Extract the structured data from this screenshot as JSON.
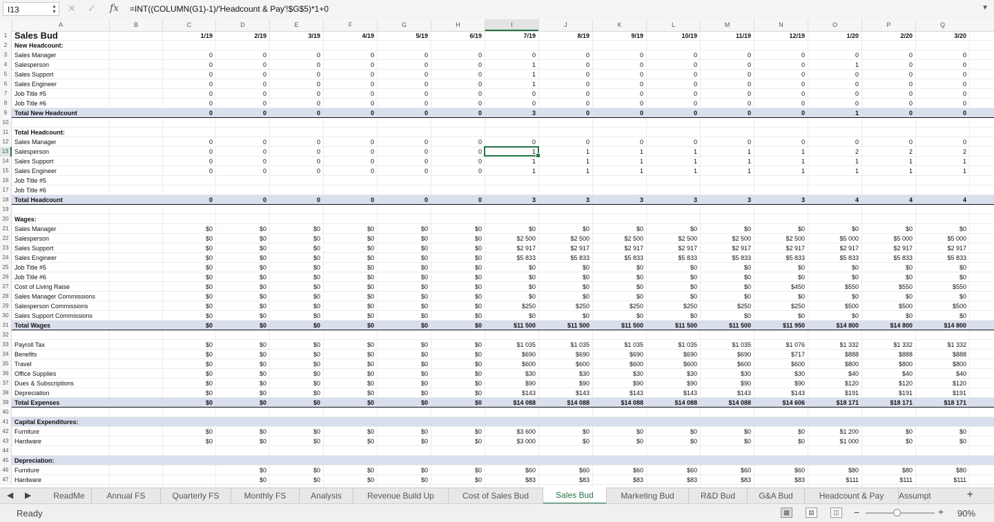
{
  "name_box": "I13",
  "formula": "=INT((COLUMN(G1)-1)/'Headcount & Pay'!$G$5)*1+0",
  "icons": {
    "cancel": "close-icon",
    "enter": "check-icon",
    "fx": "fx-icon"
  },
  "columns": [
    "A",
    "B",
    "C",
    "D",
    "E",
    "F",
    "G",
    "H",
    "I",
    "J",
    "K",
    "L",
    "M",
    "N",
    "O",
    "P",
    "Q"
  ],
  "selected_column": "I",
  "selected_row": 13,
  "selected_value": "1",
  "sheet_title": "Sales Bud",
  "rows": [
    {
      "n": 1,
      "label": "Sales Bud",
      "style": "title",
      "values": [
        "1/19",
        "2/19",
        "3/19",
        "4/19",
        "5/19",
        "6/19",
        "7/19",
        "8/19",
        "9/19",
        "10/19",
        "11/19",
        "12/19",
        "1/20",
        "2/20",
        "3/20"
      ],
      "bold": true
    },
    {
      "n": 2,
      "label": "New Headcount:",
      "style": "b",
      "values": []
    },
    {
      "n": 3,
      "label": "Sales Manager",
      "values": [
        "0",
        "0",
        "0",
        "0",
        "0",
        "0",
        "0",
        "0",
        "0",
        "0",
        "0",
        "0",
        "0",
        "0",
        "0"
      ]
    },
    {
      "n": 4,
      "label": "Salesperson",
      "values": [
        "0",
        "0",
        "0",
        "0",
        "0",
        "0",
        "1",
        "0",
        "0",
        "0",
        "0",
        "0",
        "1",
        "0",
        "0"
      ]
    },
    {
      "n": 5,
      "label": "Sales Support",
      "values": [
        "0",
        "0",
        "0",
        "0",
        "0",
        "0",
        "1",
        "0",
        "0",
        "0",
        "0",
        "0",
        "0",
        "0",
        "0"
      ]
    },
    {
      "n": 6,
      "label": "Sales Engineer",
      "values": [
        "0",
        "0",
        "0",
        "0",
        "0",
        "0",
        "1",
        "0",
        "0",
        "0",
        "0",
        "0",
        "0",
        "0",
        "0"
      ]
    },
    {
      "n": 7,
      "label": "Job Title #5",
      "values": [
        "0",
        "0",
        "0",
        "0",
        "0",
        "0",
        "0",
        "0",
        "0",
        "0",
        "0",
        "0",
        "0",
        "0",
        "0"
      ]
    },
    {
      "n": 8,
      "label": "Job Title #6",
      "values": [
        "0",
        "0",
        "0",
        "0",
        "0",
        "0",
        "0",
        "0",
        "0",
        "0",
        "0",
        "0",
        "0",
        "0",
        "0"
      ]
    },
    {
      "n": 9,
      "label": "Total New Headcount",
      "style": "b",
      "band": true,
      "total": true,
      "bold": true,
      "values": [
        "0",
        "0",
        "0",
        "0",
        "0",
        "0",
        "3",
        "0",
        "0",
        "0",
        "0",
        "0",
        "1",
        "0",
        "0"
      ]
    },
    {
      "n": 10,
      "label": "",
      "values": []
    },
    {
      "n": 11,
      "label": "Total Headcount:",
      "style": "b",
      "values": []
    },
    {
      "n": 12,
      "label": "Sales Manager",
      "values": [
        "0",
        "0",
        "0",
        "0",
        "0",
        "0",
        "0",
        "0",
        "0",
        "0",
        "0",
        "0",
        "0",
        "0",
        "0"
      ]
    },
    {
      "n": 13,
      "label": "Salesperson",
      "values": [
        "0",
        "0",
        "0",
        "0",
        "0",
        "0",
        "1",
        "1",
        "1",
        "1",
        "1",
        "1",
        "2",
        "2",
        "2"
      ]
    },
    {
      "n": 14,
      "label": "Sales Support",
      "values": [
        "0",
        "0",
        "0",
        "0",
        "0",
        "0",
        "1",
        "1",
        "1",
        "1",
        "1",
        "1",
        "1",
        "1",
        "1"
      ]
    },
    {
      "n": 15,
      "label": "Sales Engineer",
      "values": [
        "0",
        "0",
        "0",
        "0",
        "0",
        "0",
        "1",
        "1",
        "1",
        "1",
        "1",
        "1",
        "1",
        "1",
        "1"
      ]
    },
    {
      "n": 16,
      "label": "Job Title #5",
      "values": []
    },
    {
      "n": 17,
      "label": "Job Title #6",
      "values": []
    },
    {
      "n": 18,
      "label": "Total Headcount",
      "style": "b",
      "band": true,
      "total": true,
      "bold": true,
      "values": [
        "0",
        "0",
        "0",
        "0",
        "0",
        "0",
        "3",
        "3",
        "3",
        "3",
        "3",
        "3",
        "4",
        "4",
        "4"
      ]
    },
    {
      "n": 19,
      "label": "",
      "values": []
    },
    {
      "n": 20,
      "label": "Wages:",
      "style": "b",
      "values": []
    },
    {
      "n": 21,
      "label": "Sales Manager",
      "values": [
        "$0",
        "$0",
        "$0",
        "$0",
        "$0",
        "$0",
        "$0",
        "$0",
        "$0",
        "$0",
        "$0",
        "$0",
        "$0",
        "$0",
        "$0"
      ]
    },
    {
      "n": 22,
      "label": "Salesperson",
      "values": [
        "$0",
        "$0",
        "$0",
        "$0",
        "$0",
        "$0",
        "$2 500",
        "$2 500",
        "$2 500",
        "$2 500",
        "$2 500",
        "$2 500",
        "$5 000",
        "$5 000",
        "$5 000"
      ]
    },
    {
      "n": 23,
      "label": "Sales Support",
      "values": [
        "$0",
        "$0",
        "$0",
        "$0",
        "$0",
        "$0",
        "$2 917",
        "$2 917",
        "$2 917",
        "$2 917",
        "$2 917",
        "$2 917",
        "$2 917",
        "$2 917",
        "$2 917"
      ]
    },
    {
      "n": 24,
      "label": "Sales Engineer",
      "values": [
        "$0",
        "$0",
        "$0",
        "$0",
        "$0",
        "$0",
        "$5 833",
        "$5 833",
        "$5 833",
        "$5 833",
        "$5 833",
        "$5 833",
        "$5 833",
        "$5 833",
        "$5 833"
      ]
    },
    {
      "n": 25,
      "label": "Job Title #5",
      "values": [
        "$0",
        "$0",
        "$0",
        "$0",
        "$0",
        "$0",
        "$0",
        "$0",
        "$0",
        "$0",
        "$0",
        "$0",
        "$0",
        "$0",
        "$0"
      ]
    },
    {
      "n": 26,
      "label": "Job Title #6",
      "values": [
        "$0",
        "$0",
        "$0",
        "$0",
        "$0",
        "$0",
        "$0",
        "$0",
        "$0",
        "$0",
        "$0",
        "$0",
        "$0",
        "$0",
        "$0"
      ]
    },
    {
      "n": 27,
      "label": "Cost of Living Raise",
      "values": [
        "$0",
        "$0",
        "$0",
        "$0",
        "$0",
        "$0",
        "$0",
        "$0",
        "$0",
        "$0",
        "$0",
        "$450",
        "$550",
        "$550",
        "$550"
      ]
    },
    {
      "n": 28,
      "label": "Sales Manager Commissions",
      "values": [
        "$0",
        "$0",
        "$0",
        "$0",
        "$0",
        "$0",
        "$0",
        "$0",
        "$0",
        "$0",
        "$0",
        "$0",
        "$0",
        "$0",
        "$0"
      ]
    },
    {
      "n": 29,
      "label": "Salesperson Commissions",
      "values": [
        "$0",
        "$0",
        "$0",
        "$0",
        "$0",
        "$0",
        "$250",
        "$250",
        "$250",
        "$250",
        "$250",
        "$250",
        "$500",
        "$500",
        "$500"
      ]
    },
    {
      "n": 30,
      "label": "Sales Support Commissions",
      "values": [
        "$0",
        "$0",
        "$0",
        "$0",
        "$0",
        "$0",
        "$0",
        "$0",
        "$0",
        "$0",
        "$0",
        "$0",
        "$0",
        "$0",
        "$0"
      ]
    },
    {
      "n": 31,
      "label": "Total Wages",
      "style": "b",
      "band": true,
      "total": true,
      "bold": true,
      "values": [
        "$0",
        "$0",
        "$0",
        "$0",
        "$0",
        "$0",
        "$11 500",
        "$11 500",
        "$11 500",
        "$11 500",
        "$11 500",
        "$11 950",
        "$14 800",
        "$14 800",
        "$14 800"
      ]
    },
    {
      "n": 32,
      "label": "",
      "values": []
    },
    {
      "n": 33,
      "label": "Payroll Tax",
      "values": [
        "$0",
        "$0",
        "$0",
        "$0",
        "$0",
        "$0",
        "$1 035",
        "$1 035",
        "$1 035",
        "$1 035",
        "$1 035",
        "$1 076",
        "$1 332",
        "$1 332",
        "$1 332"
      ]
    },
    {
      "n": 34,
      "label": "Benefits",
      "values": [
        "$0",
        "$0",
        "$0",
        "$0",
        "$0",
        "$0",
        "$690",
        "$690",
        "$690",
        "$690",
        "$690",
        "$717",
        "$888",
        "$888",
        "$888"
      ]
    },
    {
      "n": 35,
      "label": "Travel",
      "values": [
        "$0",
        "$0",
        "$0",
        "$0",
        "$0",
        "$0",
        "$600",
        "$600",
        "$600",
        "$600",
        "$600",
        "$600",
        "$800",
        "$800",
        "$800"
      ]
    },
    {
      "n": 36,
      "label": "Office Supplies",
      "values": [
        "$0",
        "$0",
        "$0",
        "$0",
        "$0",
        "$0",
        "$30",
        "$30",
        "$30",
        "$30",
        "$30",
        "$30",
        "$40",
        "$40",
        "$40"
      ]
    },
    {
      "n": 37,
      "label": "Dues & Subscriptions",
      "values": [
        "$0",
        "$0",
        "$0",
        "$0",
        "$0",
        "$0",
        "$90",
        "$90",
        "$90",
        "$90",
        "$90",
        "$90",
        "$120",
        "$120",
        "$120"
      ]
    },
    {
      "n": 38,
      "label": "Depreciation",
      "values": [
        "$0",
        "$0",
        "$0",
        "$0",
        "$0",
        "$0",
        "$143",
        "$143",
        "$143",
        "$143",
        "$143",
        "$143",
        "$191",
        "$191",
        "$191"
      ]
    },
    {
      "n": 39,
      "label": "Total Expenses",
      "style": "b",
      "band": true,
      "total": true,
      "bold": true,
      "values": [
        "$0",
        "$0",
        "$0",
        "$0",
        "$0",
        "$0",
        "$14 088",
        "$14 088",
        "$14 088",
        "$14 088",
        "$14 088",
        "$14 606",
        "$18 171",
        "$18 171",
        "$18 171"
      ]
    },
    {
      "n": 40,
      "label": "",
      "values": []
    },
    {
      "n": 41,
      "label": "Capital Expenditures:",
      "style": "b",
      "band": true,
      "values": []
    },
    {
      "n": 42,
      "label": "Furniture",
      "values": [
        "$0",
        "$0",
        "$0",
        "$0",
        "$0",
        "$0",
        "$3 600",
        "$0",
        "$0",
        "$0",
        "$0",
        "$0",
        "$1 200",
        "$0",
        "$0"
      ]
    },
    {
      "n": 43,
      "label": "Hardware",
      "values": [
        "$0",
        "$0",
        "$0",
        "$0",
        "$0",
        "$0",
        "$3 000",
        "$0",
        "$0",
        "$0",
        "$0",
        "$0",
        "$1 000",
        "$0",
        "$0"
      ]
    },
    {
      "n": 44,
      "label": "",
      "values": []
    },
    {
      "n": 45,
      "label": "Depreciation:",
      "style": "b",
      "band": true,
      "values": []
    },
    {
      "n": 46,
      "label": "Furniture",
      "values": [
        "",
        "$0",
        "$0",
        "$0",
        "$0",
        "$0",
        "$60",
        "$60",
        "$60",
        "$60",
        "$60",
        "$60",
        "$80",
        "$80",
        "$80"
      ]
    },
    {
      "n": 47,
      "label": "Hardware",
      "values": [
        "",
        "$0",
        "$0",
        "$0",
        "$0",
        "$0",
        "$83",
        "$83",
        "$83",
        "$83",
        "$83",
        "$83",
        "$111",
        "$111",
        "$111"
      ]
    }
  ],
  "tabs": [
    "ReadMe",
    "Annual FS",
    "Quarterly FS",
    "Monthly FS",
    "Analysis",
    "Revenue Build Up",
    "Cost of Sales Bud",
    "Sales Bud",
    "Marketing Bud",
    "R&D Bud",
    "G&A Bud",
    "Headcount & Pay",
    "Assumpt"
  ],
  "active_tab": "Sales Bud",
  "add_sheet": "+",
  "status": {
    "ready": "Ready",
    "zoom": "90%",
    "zoom_minus": "−",
    "zoom_plus": "+",
    "zoom_fraction": 0.45
  }
}
